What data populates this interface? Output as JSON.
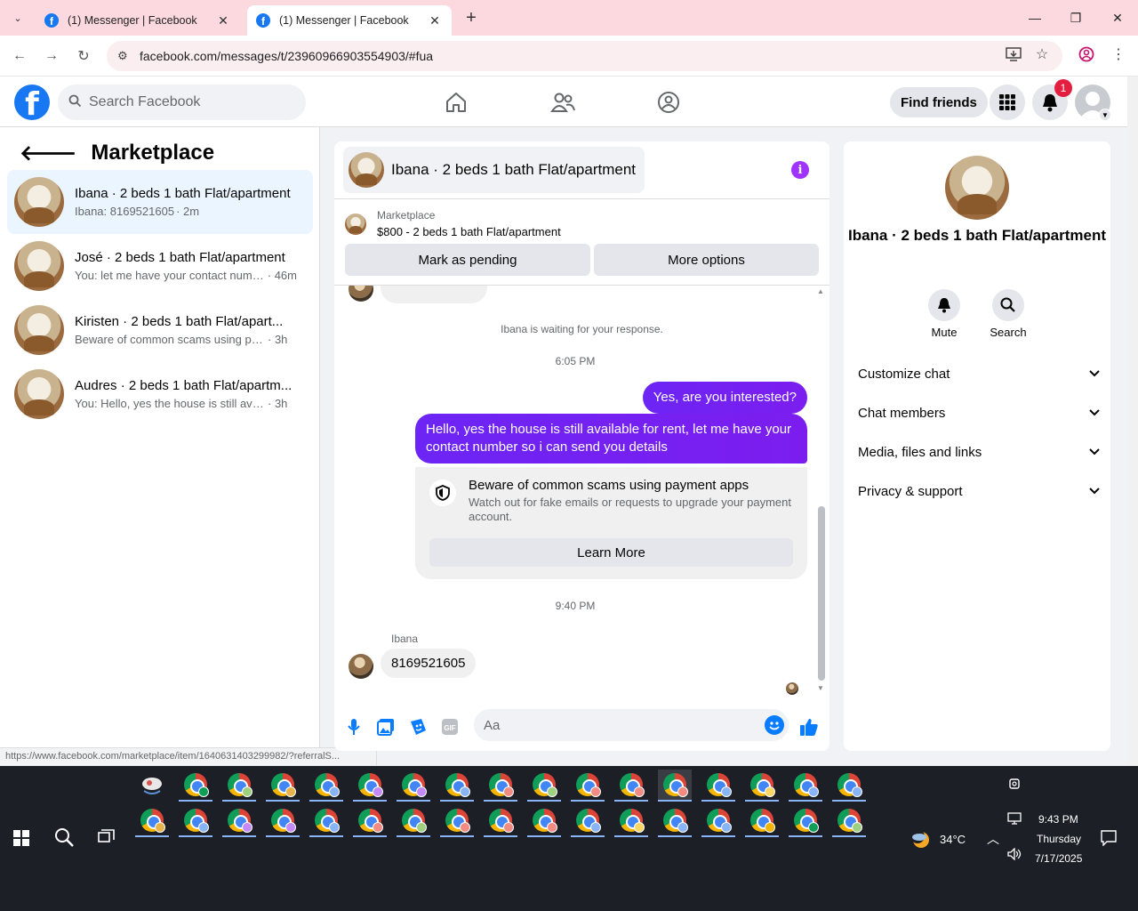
{
  "browser": {
    "tabs": [
      {
        "title": "(1) Messenger | Facebook"
      },
      {
        "title": "(1) Messenger | Facebook"
      }
    ],
    "url": "facebook.com/messages/t/23960966903554903/#fua",
    "status_url": "https://www.facebook.com/marketplace/item/1640631403299982/?referralS..."
  },
  "header": {
    "search_placeholder": "Search Facebook",
    "find_friends": "Find friends",
    "notif_count": "1"
  },
  "sidebar": {
    "title": "Marketplace",
    "conversations": [
      {
        "name": "Ibana · 2 beds 1 bath Flat/apartment",
        "preview": "Ibana: 8169521605",
        "time": "· 2m"
      },
      {
        "name": "José · 2 beds 1 bath Flat/apartment",
        "preview": "You: let me have your contact numb...",
        "time": "· 46m"
      },
      {
        "name": "Kiristen · 2 beds 1 bath Flat/apart...",
        "preview": "Beware of common scams using pay...",
        "time": "· 3h"
      },
      {
        "name": "Audres · 2 beds 1 bath Flat/apartm...",
        "preview": "You: Hello, yes the house is still availa...",
        "time": "· 3h"
      }
    ]
  },
  "chat": {
    "title": "Ibana · 2 beds 1 bath Flat/apartment",
    "marketplace_label": "Marketplace",
    "listing": "$800 - 2 beds 1 bath Flat/apartment",
    "mark_pending": "Mark as pending",
    "more_options": "More options",
    "waiting": "Ibana is waiting for your response.",
    "time1": "6:05 PM",
    "out1": "Yes, are you interested?",
    "out2": "Hello, yes the house is still available for rent, let me have your contact number so i can send you details",
    "scam_title": "Beware of common scams using payment apps",
    "scam_body": "Watch out for fake emails or requests to upgrade your payment account.",
    "learn_more": "Learn More",
    "time2": "9:40 PM",
    "sender": "Ibana",
    "in1": "8169521605",
    "composer_placeholder": "Aa"
  },
  "right_panel": {
    "name": "Ibana · 2 beds 1 bath Flat/apartment",
    "mute": "Mute",
    "search": "Search",
    "sections": [
      "Customize chat",
      "Chat members",
      "Media, files and links",
      "Privacy & support"
    ]
  },
  "taskbar": {
    "weather": "34°C",
    "time": "9:43 PM",
    "day": "Thursday",
    "date": "7/17/2025"
  },
  "colors": {
    "fb_blue": "#1877f2",
    "bubble_out": "#7b1ff0",
    "tab_pink": "#fcd9df",
    "active_convo": "#ebf5ff"
  }
}
